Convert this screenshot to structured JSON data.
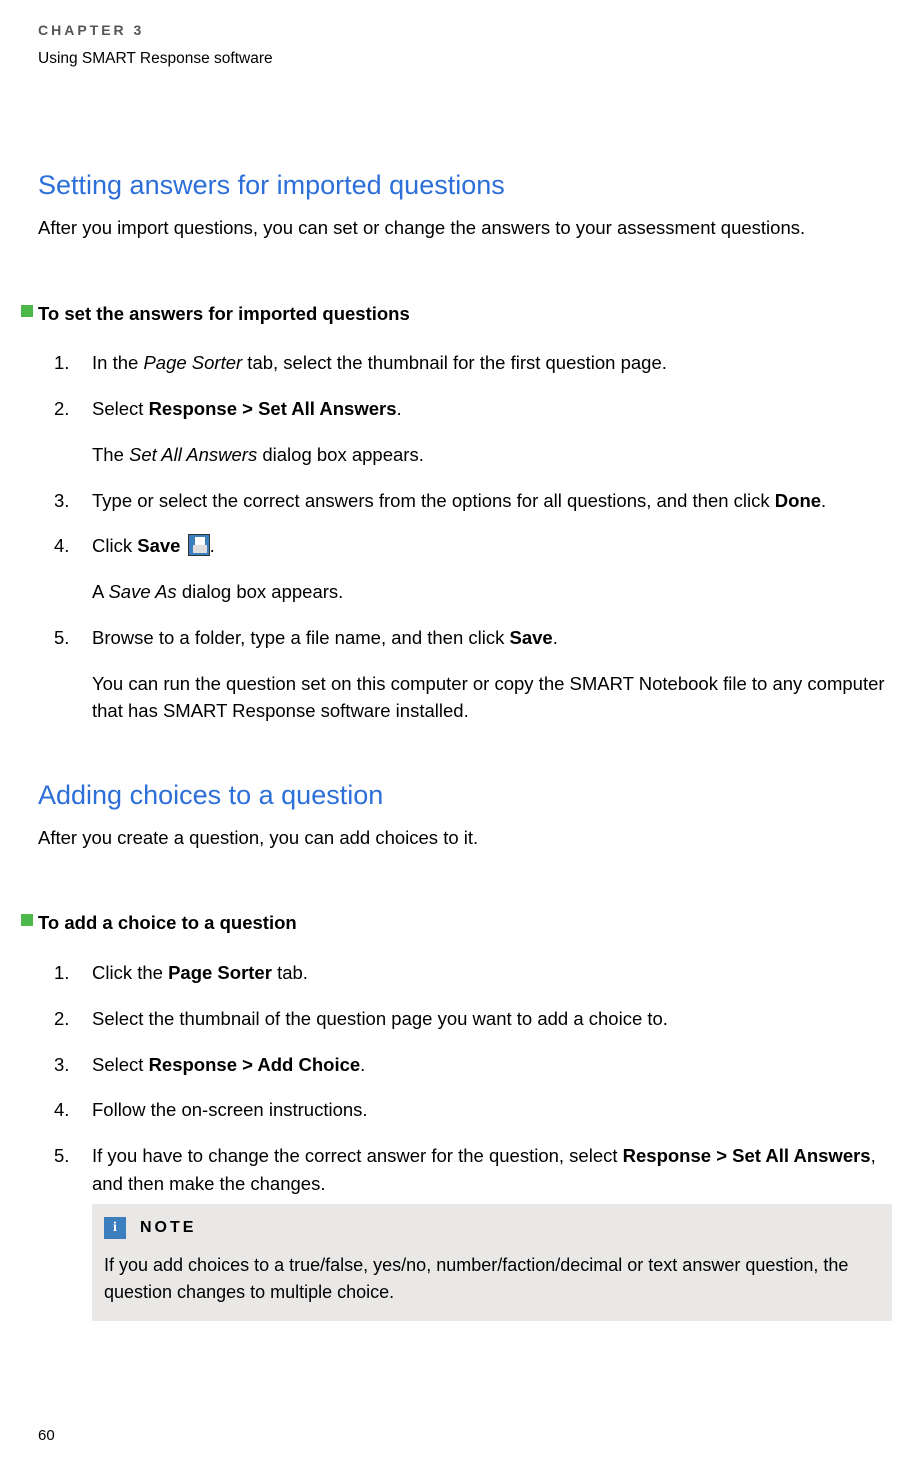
{
  "header": {
    "chapter_label": "CHAPTER 3",
    "chapter_subtitle": "Using SMART Response software"
  },
  "section1": {
    "heading": "Setting answers for imported questions",
    "intro": "After you import questions, you can set or change the answers to your assessment questions.",
    "procedure_heading": "To set the answers for imported questions",
    "steps": {
      "s1": {
        "num": "1.",
        "pre": "In the ",
        "em": "Page Sorter",
        "post": " tab, select the thumbnail for the first question page."
      },
      "s2": {
        "num": "2.",
        "pre": "Select ",
        "b": "Response > Set All Answers",
        "post": ".",
        "extra_pre": "The ",
        "extra_em": "Set All Answers",
        "extra_post": " dialog box appears."
      },
      "s3": {
        "num": "3.",
        "pre": "Type or select the correct answers from the options for all questions, and then click ",
        "b": "Done",
        "post": "."
      },
      "s4": {
        "num": "4.",
        "pre": "Click ",
        "b": "Save",
        "post_icon": ".",
        "extra_pre": "A ",
        "extra_em": "Save As",
        "extra_post": " dialog box appears."
      },
      "s5": {
        "num": "5.",
        "pre": "Browse to a folder, type a file name, and then click ",
        "b": "Save",
        "post": ".",
        "extra": "You can run the question set on this computer or copy the SMART Notebook file to any computer that has SMART Response software installed."
      }
    }
  },
  "section2": {
    "heading": "Adding choices to a question",
    "intro": "After you create a question, you can add choices to it.",
    "procedure_heading": "To add a choice to a question",
    "steps": {
      "s1": {
        "num": "1.",
        "pre": "Click the ",
        "b": "Page Sorter",
        "post": " tab."
      },
      "s2": {
        "num": "2.",
        "text": "Select the thumbnail of the question page you want to add a choice to."
      },
      "s3": {
        "num": "3.",
        "pre": "Select ",
        "b": "Response > Add Choice",
        "post": "."
      },
      "s4": {
        "num": "4.",
        "text": "Follow the on-screen instructions."
      },
      "s5": {
        "num": "5.",
        "pre": "If you have to change the correct answer for the question, select ",
        "b": "Response > Set All Answers",
        "post": ", and then make the changes."
      }
    },
    "note": {
      "label": "NOTE",
      "text": "If you add choices to a true/false, yes/no, number/faction/decimal or text answer question, the question changes to multiple choice."
    }
  },
  "page_number": "60"
}
